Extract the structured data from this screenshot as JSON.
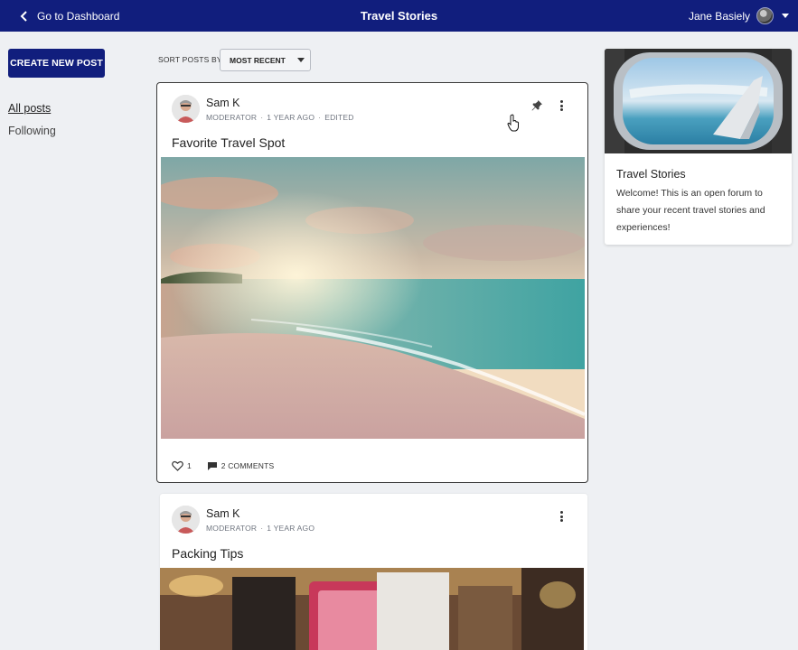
{
  "header": {
    "back_label": "Go to Dashboard",
    "title": "Travel Stories",
    "user_name": "Jane Basiely"
  },
  "sidebar": {
    "create_label": "CREATE NEW POST",
    "items": [
      {
        "label": "All posts",
        "active": true
      },
      {
        "label": "Following",
        "active": false
      }
    ]
  },
  "sort": {
    "label": "SORT POSTS BY",
    "selected": "MOST RECENT"
  },
  "posts": [
    {
      "author": "Sam K",
      "role": "MODERATOR",
      "time": "1 YEAR AGO",
      "edited": "EDITED",
      "title": "Favorite Travel Spot",
      "likes": "1",
      "comments": "2 COMMENTS"
    },
    {
      "author": "Sam K",
      "role": "MODERATOR",
      "time": "1 YEAR AGO",
      "title": "Packing Tips"
    }
  ],
  "info_card": {
    "title": "Travel Stories",
    "description": "Welcome! This is an open forum to share your recent travel stories and experiences!"
  },
  "colors": {
    "header_bg": "#111e7d",
    "page_bg": "#eef0f3"
  },
  "icons": [
    "chevron-left-icon",
    "chevron-down-icon",
    "pin-icon",
    "more-vert-icon",
    "heart-icon",
    "comment-icon",
    "hand-cursor-icon"
  ]
}
